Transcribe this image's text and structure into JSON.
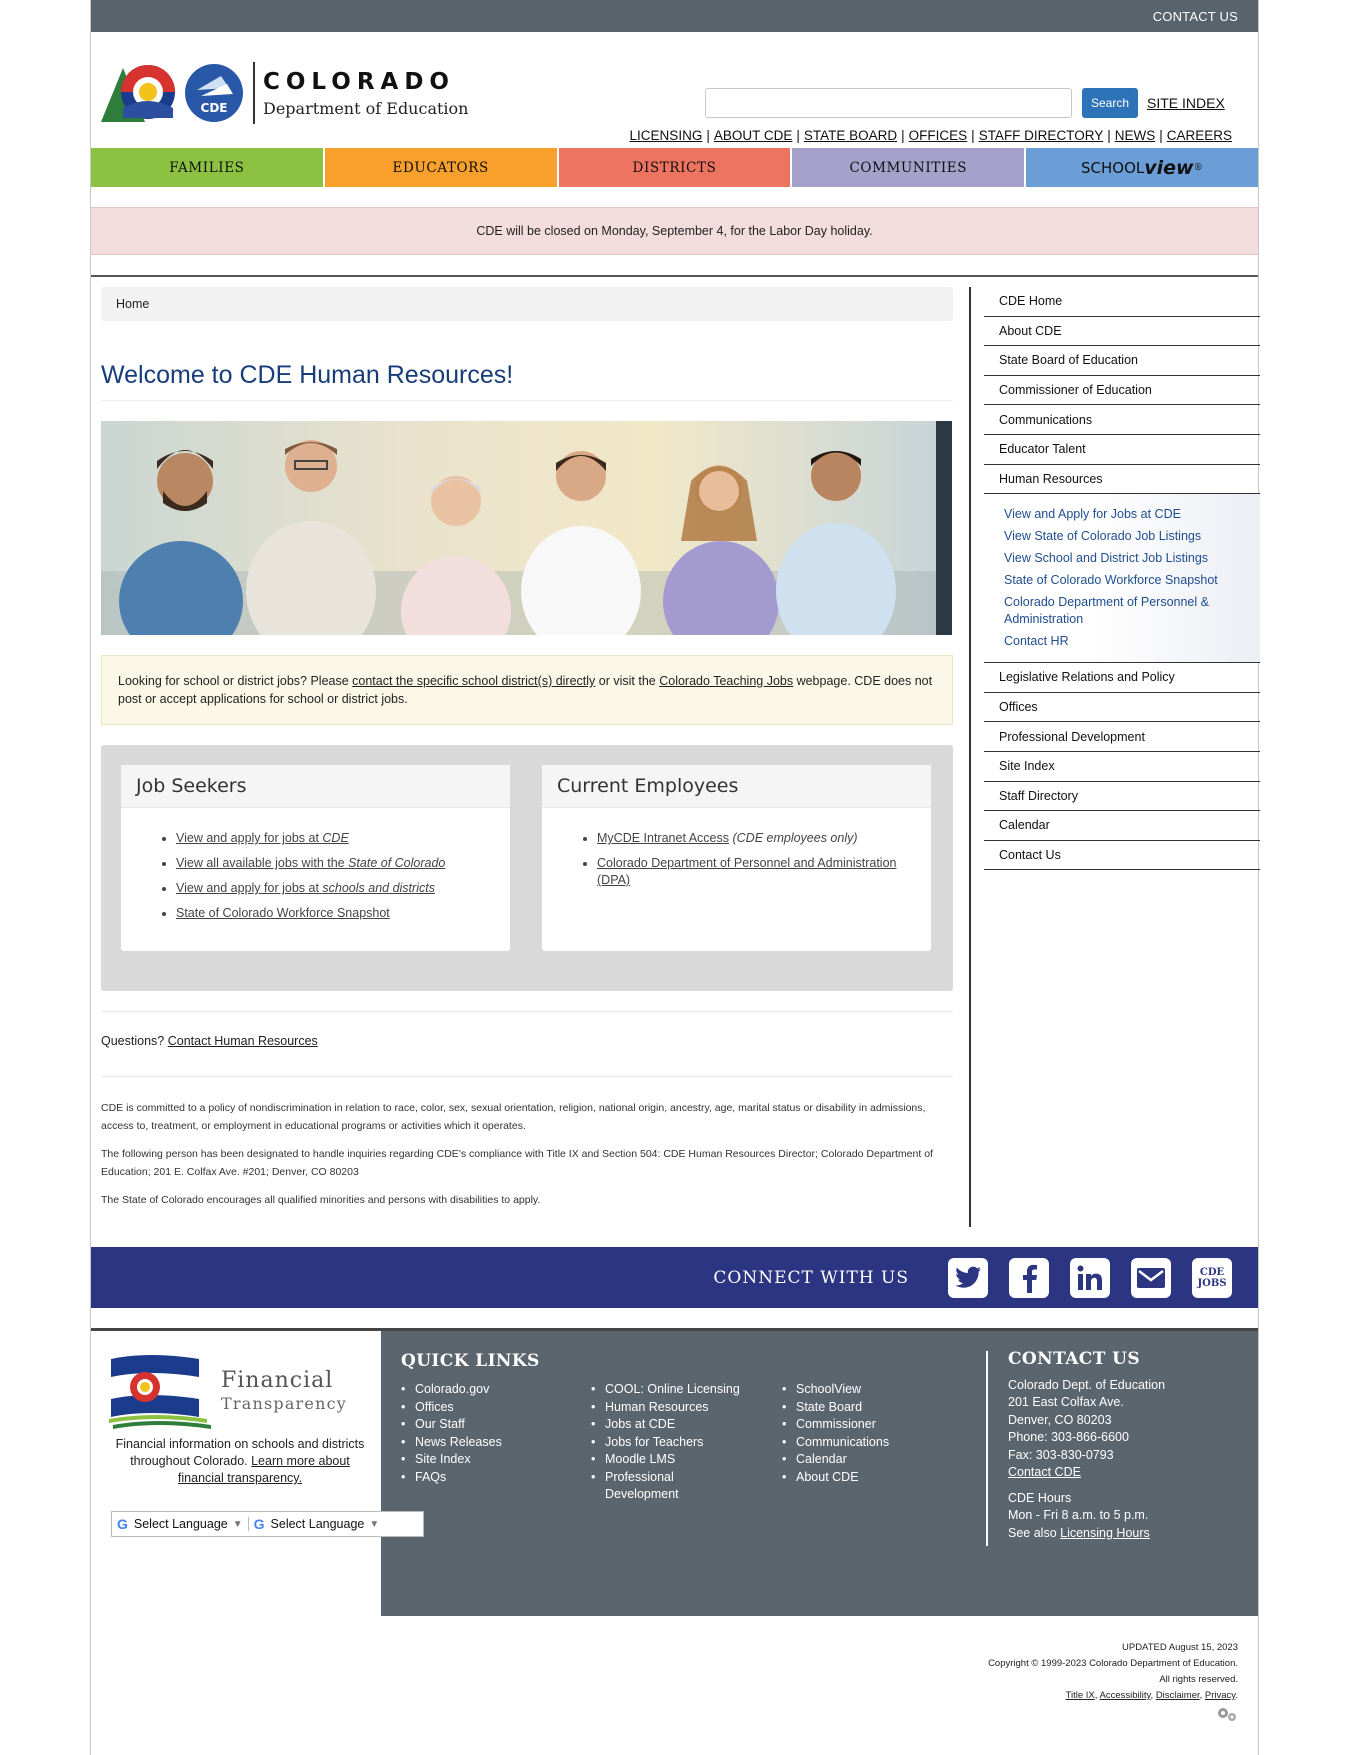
{
  "topbar": {
    "contact": "CONTACT US"
  },
  "logo": {
    "line1": "COLORADO",
    "line2": "Department of Education",
    "badge": "CDE"
  },
  "search": {
    "placeholder": "",
    "button": "Search",
    "site_index": "SITE INDEX"
  },
  "toplinks": [
    "LICENSING",
    "ABOUT CDE",
    "STATE BOARD",
    "OFFICES",
    "STAFF DIRECTORY",
    "NEWS",
    "CAREERS"
  ],
  "nav": [
    {
      "label": "FAMILIES",
      "color": "#8cc142"
    },
    {
      "label": "EDUCATORS",
      "color": "#f8a02b"
    },
    {
      "label": "DISTRICTS",
      "color": "#ee7462"
    },
    {
      "label": "COMMUNITIES",
      "color": "#a4a1cb"
    },
    {
      "label_a": "SCHOOL",
      "label_b": "view",
      "trademark": "®",
      "color": "#6b9ed6"
    }
  ],
  "alert": "CDE will be closed on Monday, September 4, for the Labor Day holiday.",
  "breadcrumb": "Home",
  "page_title": "Welcome to CDE Human Resources!",
  "notice": {
    "t1": "Looking for school or district jobs? Please ",
    "link1": "contact the specific school district(s) directly",
    "t2": " or visit the ",
    "link2": "Colorado Teaching Jobs",
    "t3": " webpage. CDE does not post or accept applications for school or district jobs."
  },
  "job_seekers": {
    "title": "Job Seekers",
    "items": [
      {
        "text": "View and apply for jobs at ",
        "em": "CDE"
      },
      {
        "text": "View all available jobs with the ",
        "em": "State of Colorado"
      },
      {
        "text": "View and apply for jobs at ",
        "em": "schools and districts"
      },
      {
        "text": "State of Colorado Workforce Snapshot",
        "em": ""
      }
    ]
  },
  "current_employees": {
    "title": "Current Employees",
    "item1_link": "MyCDE Intranet Access",
    "item1_em": " (CDE employees only)",
    "item2_link": "Colorado Department of Personnel and Administration (DPA)"
  },
  "questions": {
    "text": "Questions? ",
    "link": "Contact Human Resources"
  },
  "policy": [
    "CDE is committed to a policy of nondiscrimination in relation to race, color, sex, sexual orientation, religion, national origin, ancestry, age, marital status or disability in admissions, access to, treatment, or employment in educational programs or activities which it operates.",
    "The following person has been designated to handle inquiries regarding CDE's compliance with Title IX and Section 504: CDE Human Resources Director; Colorado Department of Education; 201 E. Colfax Ave. #201; Denver, CO 80203",
    "The State of Colorado encourages all qualified minorities and persons with disabilities to apply."
  ],
  "sidebar": {
    "items_top": [
      "CDE Home",
      "About CDE",
      "State Board of Education",
      "Commissioner of Education",
      "Communications",
      "Educator Talent",
      "Human Resources"
    ],
    "sub": [
      "View and Apply for Jobs at CDE",
      "View State of Colorado Job Listings",
      "View School and District Job Listings",
      "State of Colorado Workforce Snapshot",
      "Colorado Department of Personnel & Administration",
      "Contact HR"
    ],
    "items_bottom": [
      "Legislative Relations and Policy",
      "Offices",
      "Professional Development",
      "Site Index",
      "Staff Directory",
      "Calendar",
      "Contact Us"
    ]
  },
  "connect": {
    "label": "CONNECT WITH US",
    "jobs_icon_line1": "CDE",
    "jobs_icon_line2": "JOBS"
  },
  "financial": {
    "title1": "Financial",
    "title2": "Transparency",
    "text": "Financial information on schools and districts throughout Colorado. ",
    "link": "Learn more about financial transparency."
  },
  "language": {
    "label": "Select Language"
  },
  "quick_links": {
    "title": "QUICK LINKS",
    "col1": [
      "Colorado.gov",
      "Offices",
      "Our Staff",
      "News Releases",
      "Site Index",
      "FAQs"
    ],
    "col2": [
      "COOL: Online Licensing",
      "Human Resources",
      "Jobs at CDE",
      "Jobs for Teachers",
      "Moodle LMS",
      "Professional Development"
    ],
    "col3": [
      "SchoolView",
      "State Board",
      "Commissioner",
      "Communications",
      "Calendar",
      "About CDE"
    ]
  },
  "contact": {
    "title": "CONTACT US",
    "lines": [
      "Colorado Dept. of Education",
      "201 East Colfax Ave.",
      "Denver, CO 80203",
      "Phone: 303-866-6600",
      "Fax: 303-830-0793"
    ],
    "link": "Contact CDE",
    "hours_title": "CDE Hours",
    "hours": "Mon - Fri 8 a.m. to 5 p.m.",
    "see_also": "See also ",
    "licensing_hours": "Licensing Hours"
  },
  "bottom": {
    "updated": "UPDATED August 15, 2023",
    "copyright": "Copyright © 1999-2023 Colorado Department of Education.",
    "rights": "All rights reserved.",
    "links": [
      "Title IX",
      "Accessibility",
      "Disclaimer",
      "Privacy"
    ]
  }
}
